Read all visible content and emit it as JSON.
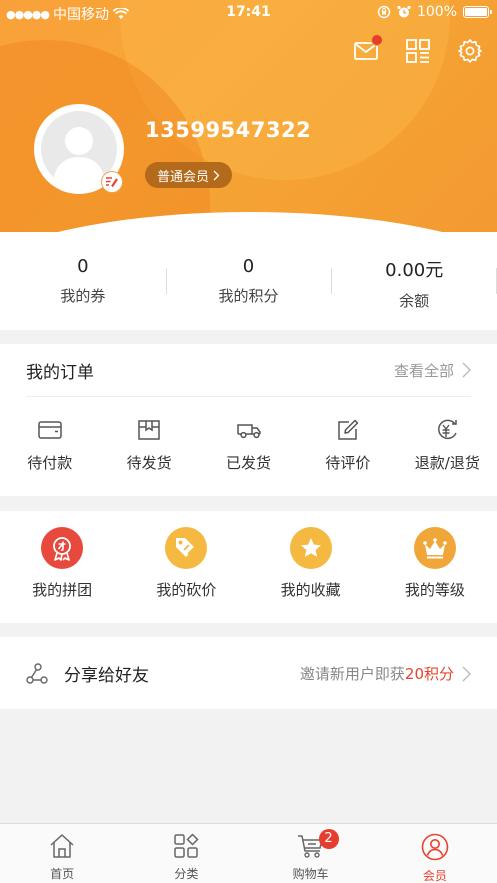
{
  "status_bar": {
    "signal_dots": "●●●●●",
    "carrier": "中国移动",
    "time": "17:41",
    "battery": "100%"
  },
  "profile": {
    "phone": "13599547322",
    "member_level": "普通会员",
    "has_unread_message": true
  },
  "stats": [
    {
      "value": "0",
      "label": "我的券"
    },
    {
      "value": "0",
      "label": "我的积分"
    },
    {
      "value": "0.00元",
      "label": "余额"
    }
  ],
  "orders": {
    "title": "我的订单",
    "view_all": "查看全部",
    "items": [
      {
        "label": "待付款",
        "icon": "wallet-icon"
      },
      {
        "label": "待发货",
        "icon": "box-icon"
      },
      {
        "label": "已发货",
        "icon": "truck-icon"
      },
      {
        "label": "待评价",
        "icon": "pencil-icon"
      },
      {
        "label": "退款/退货",
        "icon": "refund-icon"
      }
    ]
  },
  "services": [
    {
      "label": "我的拼团",
      "icon": "group-buy-icon",
      "color": "#e8493d"
    },
    {
      "label": "我的砍价",
      "icon": "bargain-icon",
      "color": "#f5b840"
    },
    {
      "label": "我的收藏",
      "icon": "star-icon",
      "color": "#f5b840"
    },
    {
      "label": "我的等级",
      "icon": "crown-icon",
      "color": "#f0a638"
    }
  ],
  "share": {
    "label": "分享给好友",
    "hint": "邀请新用户即获",
    "reward": "20积分"
  },
  "tabbar": {
    "items": [
      {
        "label": "首页",
        "icon": "home-icon"
      },
      {
        "label": "分类",
        "icon": "category-icon"
      },
      {
        "label": "购物车",
        "icon": "cart-icon",
        "badge": "2"
      },
      {
        "label": "会员",
        "icon": "user-icon",
        "active": true
      }
    ]
  },
  "colors": {
    "header_orange": "#f6a636",
    "accent_red": "#e8432f",
    "pill_brown": "#b36a1a"
  }
}
